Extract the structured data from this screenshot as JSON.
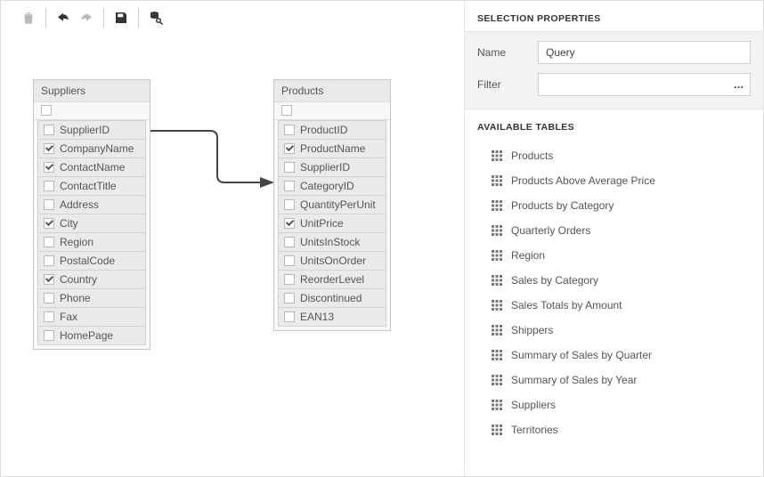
{
  "toolbar": {
    "delete_tip": "Delete",
    "undo_tip": "Undo",
    "redo_tip": "Redo",
    "save_tip": "Save",
    "preview_tip": "Preview Results"
  },
  "entities": {
    "suppliers": {
      "title": "Suppliers",
      "fields": [
        {
          "name": "SupplierID",
          "checked": false
        },
        {
          "name": "CompanyName",
          "checked": true
        },
        {
          "name": "ContactName",
          "checked": true
        },
        {
          "name": "ContactTitle",
          "checked": false
        },
        {
          "name": "Address",
          "checked": false
        },
        {
          "name": "City",
          "checked": true
        },
        {
          "name": "Region",
          "checked": false
        },
        {
          "name": "PostalCode",
          "checked": false
        },
        {
          "name": "Country",
          "checked": true
        },
        {
          "name": "Phone",
          "checked": false
        },
        {
          "name": "Fax",
          "checked": false
        },
        {
          "name": "HomePage",
          "checked": false
        }
      ]
    },
    "products": {
      "title": "Products",
      "fields": [
        {
          "name": "ProductID",
          "checked": false
        },
        {
          "name": "ProductName",
          "checked": true
        },
        {
          "name": "SupplierID",
          "checked": false
        },
        {
          "name": "CategoryID",
          "checked": false
        },
        {
          "name": "QuantityPerUnit",
          "checked": false
        },
        {
          "name": "UnitPrice",
          "checked": true
        },
        {
          "name": "UnitsInStock",
          "checked": false
        },
        {
          "name": "UnitsOnOrder",
          "checked": false
        },
        {
          "name": "ReorderLevel",
          "checked": false
        },
        {
          "name": "Discontinued",
          "checked": false
        },
        {
          "name": "EAN13",
          "checked": false
        }
      ]
    }
  },
  "panel": {
    "title": "SELECTION PROPERTIES",
    "name_label": "Name",
    "name_value": "Query",
    "filter_label": "Filter",
    "filter_value": "",
    "tables_title": "AVAILABLE TABLES",
    "tables": [
      "Products",
      "Products Above Average Price",
      "Products by Category",
      "Quarterly Orders",
      "Region",
      "Sales by Category",
      "Sales Totals by Amount",
      "Shippers",
      "Summary of Sales by Quarter",
      "Summary of Sales by Year",
      "Suppliers",
      "Territories"
    ]
  }
}
